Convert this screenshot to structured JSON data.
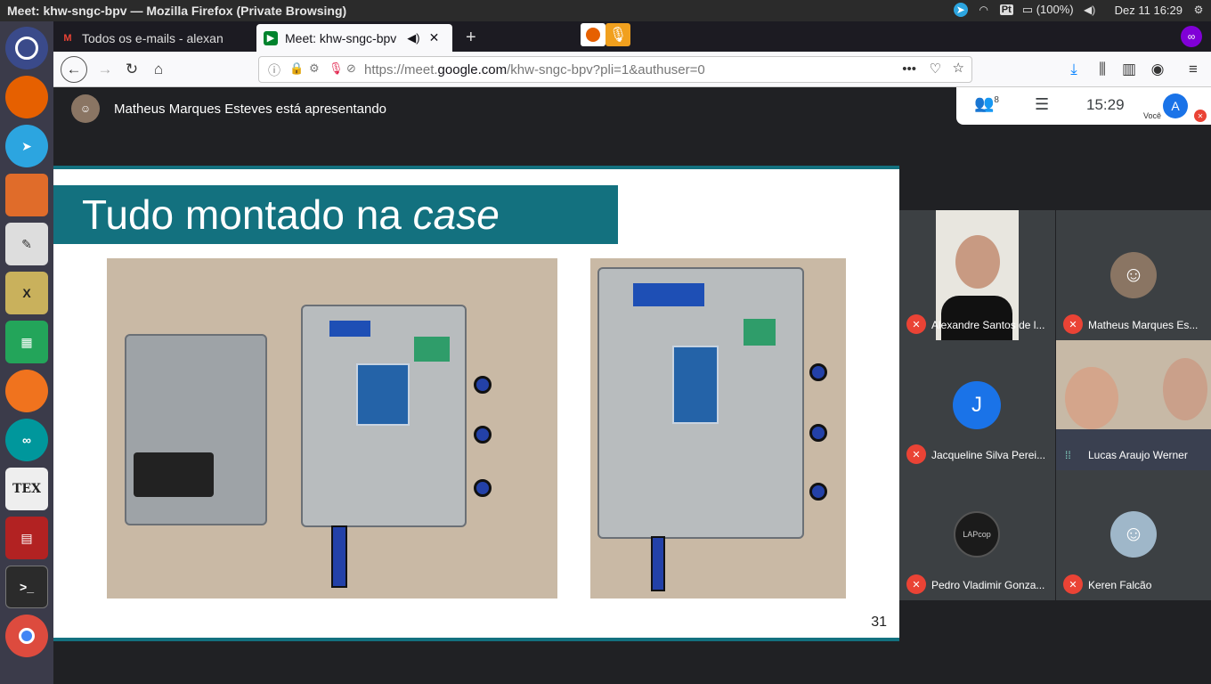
{
  "system": {
    "window_title": "Meet: khw-sngc-bpv — Mozilla Firefox (Private Browsing)",
    "language": "Pt",
    "battery": "(100%)",
    "datetime": "Dez 11 16:29"
  },
  "browser": {
    "tabs": [
      {
        "label": "Todos os e-mails - alexan",
        "icon": "gmail-icon"
      },
      {
        "label": "Meet: khw-sngc-bpv",
        "icon": "meet-icon"
      }
    ],
    "new_tab_label": "+",
    "url_prefix": "https://meet.",
    "url_domain": "google.com",
    "url_suffix": "/khw-sngc-bpv?pli=1&authuser=0",
    "url_more": "•••"
  },
  "meet": {
    "presenter_text": "Matheus Marques Esteves está apresentando",
    "participants_count": "8",
    "clock": "15:29",
    "self_initial": "A",
    "self_label": "Você",
    "slide": {
      "title_main": "Tudo montado na ",
      "title_italic": "case",
      "number": "31"
    },
    "participants": [
      {
        "name": "Alexandre Santos de l...",
        "initial": ""
      },
      {
        "name": "Matheus Marques Es...",
        "initial": ""
      },
      {
        "name": "Jacqueline Silva Perei...",
        "initial": "J"
      },
      {
        "name": "Lucas Araujo Werner",
        "initial": ""
      },
      {
        "name": "Pedro Vladimir Gonza...",
        "initial": "LAPcop"
      },
      {
        "name": "Keren Falcão",
        "initial": ""
      }
    ]
  },
  "colors": {
    "slide_accent": "#13717f",
    "mic_off": "#ea4335",
    "avatar_blue": "#1a73e8"
  }
}
